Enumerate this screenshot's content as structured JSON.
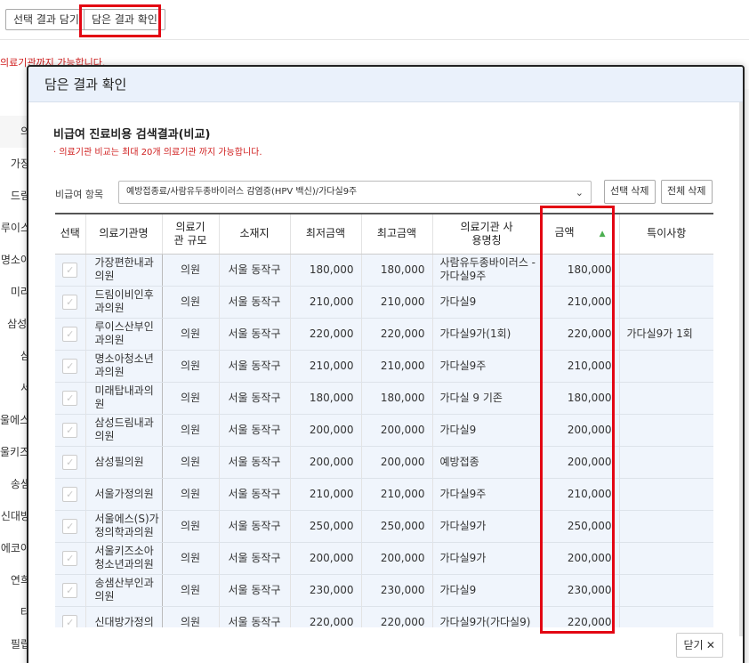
{
  "top_buttons": {
    "select_add": "선택 결과 담기",
    "view_saved": "담은 결과 확인"
  },
  "background": {
    "notice": "의료기관까지 가능합니다.",
    "column_header": "의",
    "rows": [
      "가장",
      "드림",
      "루이스",
      "명소아",
      "미라",
      "삼성.",
      "삼",
      "서",
      "울에스(",
      "울키즈소",
      "송샘",
      "신대방",
      "에코아",
      "연희",
      "타",
      "필립"
    ]
  },
  "modal": {
    "title": "담은 결과 확인",
    "section_title": "비급여 진료비용 검색결과(비교)",
    "notice": "· 의료기관 비교는 최대 20개 의료기관 까지 가능합니다.",
    "filter_label": "비급여 항목",
    "filter_value": "예방접종료/사람유두종바이러스 감염증(HPV 백신)/가다실9주",
    "delete_selected": "선택 삭제",
    "delete_all": "전체 삭제",
    "close": "닫기 ✕",
    "columns": {
      "select": "선택",
      "name": "의료기관명",
      "scale": "의료기관 규모",
      "location": "소재지",
      "min_price": "최저금액",
      "max_price": "최고금액",
      "usage_name": "의료기관 사용명칭",
      "amount": "금액",
      "remarks": "특이사항"
    },
    "rows": [
      {
        "name": "가장편한내과의원",
        "scale": "의원",
        "location": "서울 동작구",
        "min": "180,000",
        "max": "180,000",
        "usage": "사람유두종바이러스 - 가다실9주",
        "amount": "180,000",
        "remarks": ""
      },
      {
        "name": "드림이비인후과의원",
        "scale": "의원",
        "location": "서울 동작구",
        "min": "210,000",
        "max": "210,000",
        "usage": "가다실9",
        "amount": "210,000",
        "remarks": ""
      },
      {
        "name": "루이스산부인과의원",
        "scale": "의원",
        "location": "서울 동작구",
        "min": "220,000",
        "max": "220,000",
        "usage": "가다실9가(1회)",
        "amount": "220,000",
        "remarks": "가다실9가 1회"
      },
      {
        "name": "명소아청소년과의원",
        "scale": "의원",
        "location": "서울 동작구",
        "min": "210,000",
        "max": "210,000",
        "usage": "가다실9주",
        "amount": "210,000",
        "remarks": ""
      },
      {
        "name": "미래탑내과의원",
        "scale": "의원",
        "location": "서울 동작구",
        "min": "180,000",
        "max": "180,000",
        "usage": "가다실 9 기존",
        "amount": "180,000",
        "remarks": ""
      },
      {
        "name": "삼성드림내과의원",
        "scale": "의원",
        "location": "서울 동작구",
        "min": "200,000",
        "max": "200,000",
        "usage": "가다실9",
        "amount": "200,000",
        "remarks": ""
      },
      {
        "name": "삼성필의원",
        "scale": "의원",
        "location": "서울 동작구",
        "min": "200,000",
        "max": "200,000",
        "usage": "예방접종",
        "amount": "200,000",
        "remarks": ""
      },
      {
        "name": "서울가정의원",
        "scale": "의원",
        "location": "서울 동작구",
        "min": "210,000",
        "max": "210,000",
        "usage": "가다실9주",
        "amount": "210,000",
        "remarks": ""
      },
      {
        "name": "서울에스(S)가정의학과의원",
        "scale": "의원",
        "location": "서울 동작구",
        "min": "250,000",
        "max": "250,000",
        "usage": "가다실9가",
        "amount": "250,000",
        "remarks": ""
      },
      {
        "name": "서울키즈소아청소년과의원",
        "scale": "의원",
        "location": "서울 동작구",
        "min": "200,000",
        "max": "200,000",
        "usage": "가다실9가",
        "amount": "200,000",
        "remarks": ""
      },
      {
        "name": "송샘산부인과의원",
        "scale": "의원",
        "location": "서울 동작구",
        "min": "230,000",
        "max": "230,000",
        "usage": "가다실9",
        "amount": "230,000",
        "remarks": ""
      },
      {
        "name": "신대방가정의",
        "scale": "의원",
        "location": "서울 동작구",
        "min": "220,000",
        "max": "220,000",
        "usage": "가다실9가(가다실9)",
        "amount": "220,000",
        "remarks": ""
      }
    ]
  }
}
